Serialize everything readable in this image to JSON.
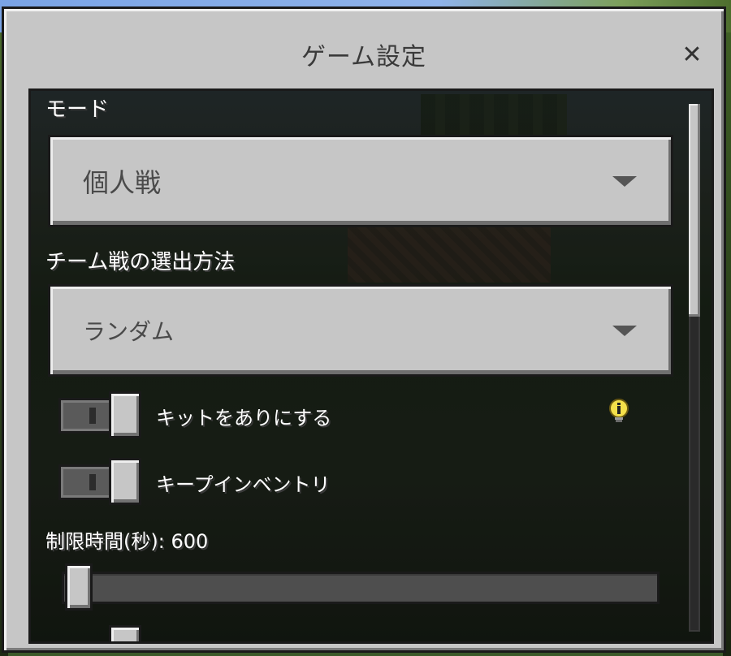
{
  "dialog": {
    "title": "ゲーム設定",
    "close_symbol": "✕"
  },
  "mode": {
    "label": "モード",
    "selected": "個人戦"
  },
  "team_selection": {
    "label": "チーム戦の選出方法",
    "selected": "ランダム"
  },
  "toggles": [
    {
      "label": "キットをありにする",
      "icon": "toggle-switch",
      "state": "off"
    },
    {
      "label": "キープインベントリ",
      "icon": "toggle-switch",
      "state": "off"
    }
  ],
  "info_icon": "lightbulb-info-icon",
  "time_limit": {
    "label": "制限時間(秒): 600",
    "value": 600,
    "fraction": 0.0
  },
  "colors": {
    "panel": "#c6c6c6",
    "border": "#1a1a1a",
    "label_text": "#ffffff",
    "info_icon": "#f4e04a"
  }
}
